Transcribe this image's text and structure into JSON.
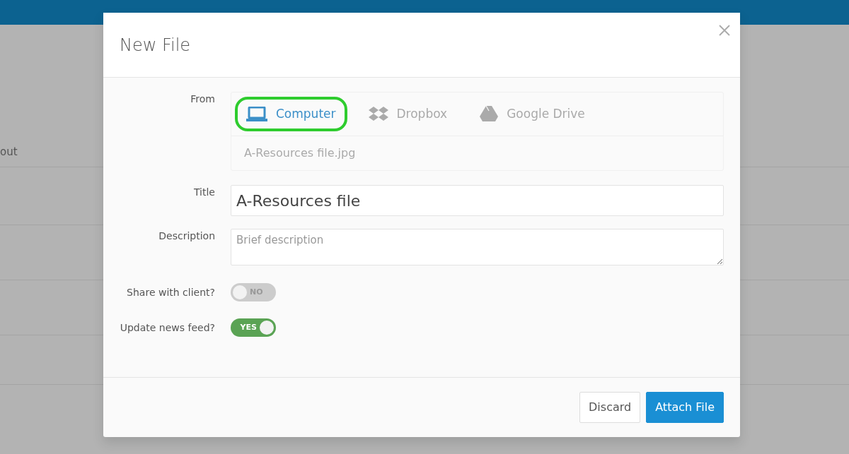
{
  "background": {
    "column_heading": "out"
  },
  "modal": {
    "title": "New File",
    "from": {
      "label": "From",
      "sources": [
        {
          "label": "Computer",
          "kind": "computer",
          "selected": true
        },
        {
          "label": "Dropbox",
          "kind": "dropbox",
          "selected": false
        },
        {
          "label": "Google Drive",
          "kind": "drive",
          "selected": false
        }
      ],
      "file_name": "A-Resources file.jpg"
    },
    "title_field": {
      "label": "Title",
      "value": "A-Resources file"
    },
    "description_field": {
      "label": "Description",
      "placeholder": "Brief description"
    },
    "toggles": [
      {
        "label": "Share with client?",
        "on": false,
        "text": "NO"
      },
      {
        "label": "Update news feed?",
        "on": true,
        "text": "YES"
      }
    ],
    "buttons": [
      {
        "label": "Discard",
        "kind": "secondary"
      },
      {
        "label": "Attach File",
        "kind": "primary"
      }
    ]
  }
}
